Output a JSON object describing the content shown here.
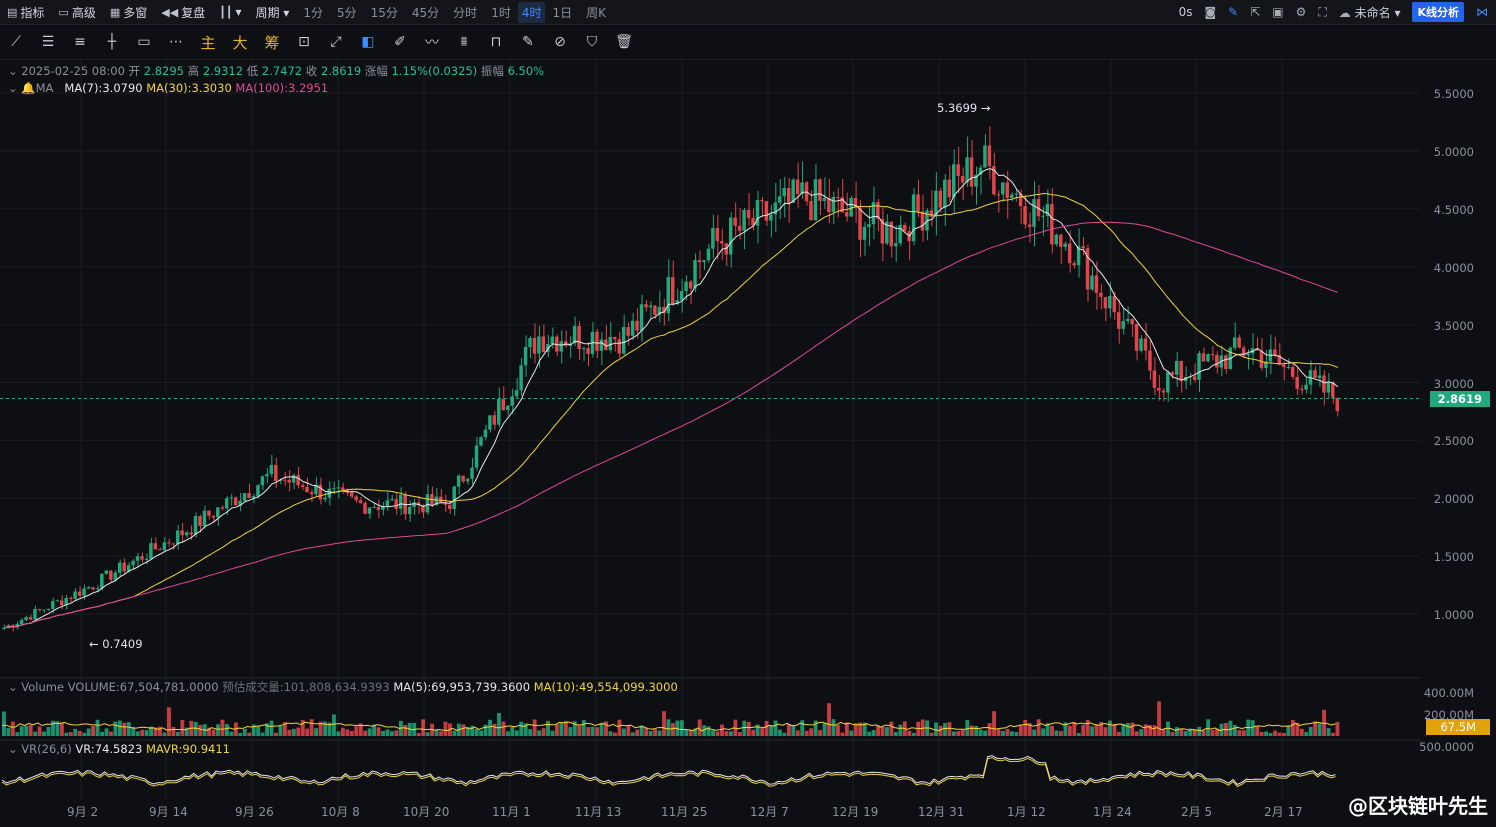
{
  "topbar": {
    "items": [
      {
        "icon": "chart-icon",
        "label": "指标"
      },
      {
        "icon": "calendar-icon",
        "label": "高级"
      },
      {
        "icon": "grid-icon",
        "label": "多窗"
      },
      {
        "icon": "rewind-icon",
        "label": "复盘"
      },
      {
        "icon": "candle-icon",
        "label": "▾"
      },
      {
        "icon": "",
        "label": "周期 ▾"
      }
    ],
    "periods": [
      "1分",
      "5分",
      "15分",
      "45分",
      "分时",
      "1时",
      "4时",
      "1日",
      "周K"
    ],
    "active_period": "4时",
    "right": {
      "time": "0s",
      "account": "未命名",
      "analysis": "K线分析"
    }
  },
  "toolbar": {
    "tools": [
      "line-tool-icon",
      "hline-tool-icon",
      "parallel-tool-icon",
      "cross-tool-icon",
      "rect-tool-icon",
      "more-tool-icon",
      "主",
      "大",
      "筹",
      "measure-icon",
      "brush-icon",
      "magnet-icon",
      "pencil-icon",
      "path-icon",
      "pattern-icon",
      "lock-icon",
      "edit-icon",
      "eraser-icon",
      "filter-icon",
      "trash-icon"
    ]
  },
  "info": {
    "date": "2025-02-25 08:00",
    "open_label": "开",
    "open": "2.8295",
    "high_label": "高",
    "high": "2.9312",
    "low_label": "低",
    "low": "2.7472",
    "close_label": "收",
    "close": "2.8619",
    "change_label": "涨幅",
    "change": "1.15%(0.0325)",
    "amp_label": "振幅",
    "amp": "6.50%",
    "ma_label": "MA",
    "ma7": "MA(7):3.0790",
    "ma30": "MA(30):3.3030",
    "ma100": "MA(100):3.2951"
  },
  "price_scale": [
    "5.5000",
    "5.0000",
    "4.5000",
    "4.0000",
    "3.5000",
    "3.0000",
    "2.5000",
    "2.0000",
    "1.5000",
    "1.0000"
  ],
  "current_price": "2.8619",
  "annotations": {
    "high": "5.3699",
    "low": "0.7409"
  },
  "volume": {
    "label": "Volume",
    "volume": "VOLUME:67,504,781.0000",
    "est": "预估成交量:101,808,634.9393",
    "ma5": "MA(5):69,953,739.3600",
    "ma10": "MA(10):49,554,099.3000",
    "scale": [
      "400.00M",
      "200.00M"
    ],
    "tag": "67.5M"
  },
  "vr": {
    "label": "VR(26,6)",
    "vr": "VR:74.5823",
    "mavr": "MAVR:90.9411",
    "scale": "500.0000"
  },
  "x_axis": [
    "9月 2",
    "9月 14",
    "9月 26",
    "10月 8",
    "10月 20",
    "11月 1",
    "11月 13",
    "11月 25",
    "12月 7",
    "12月 19",
    "12月 31",
    "1月 12",
    "1月 24",
    "2月 5",
    "2月 17"
  ],
  "watermark": "@区块链叶先生",
  "chart_data": {
    "type": "line",
    "x": [
      "9月 2",
      "9月 14",
      "9月 26",
      "10月 8",
      "10月 20",
      "11月 1",
      "11月 13",
      "11月 25",
      "12月 7",
      "12月 19",
      "12月 31",
      "1月 12",
      "1月 24",
      "2月 5",
      "2月 17",
      "2月 25"
    ],
    "series": [
      {
        "values": [
          0.88,
          1.25,
          1.7,
          2.2,
          1.95,
          1.95,
          3.4,
          3.4,
          4.2,
          4.6,
          4.3,
          4.9,
          4.2,
          3.0,
          3.3,
          2.86
        ]
      }
    ],
    "ylim": [
      0.5,
      5.6
    ]
  }
}
